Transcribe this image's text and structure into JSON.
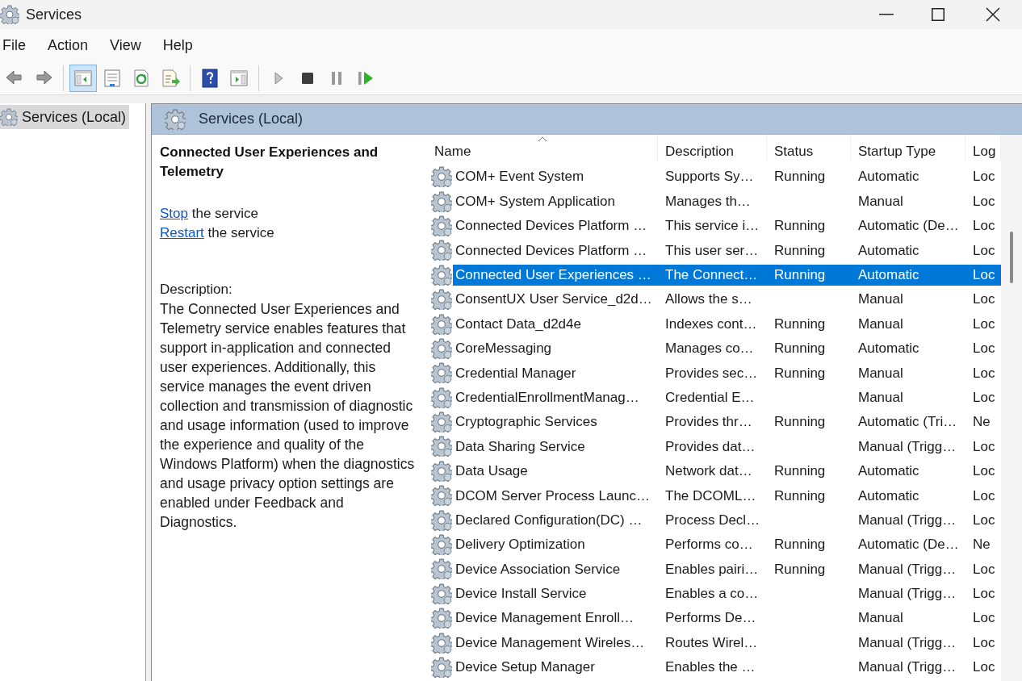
{
  "window": {
    "title": "Services"
  },
  "menu": [
    "File",
    "Action",
    "View",
    "Help"
  ],
  "toolbar": [
    {
      "kind": "back",
      "selected": false
    },
    {
      "kind": "forward",
      "selected": false
    },
    {
      "kind": "separator"
    },
    {
      "kind": "tree",
      "selected": true
    },
    {
      "kind": "properties",
      "selected": false
    },
    {
      "kind": "refresh",
      "selected": false
    },
    {
      "kind": "export",
      "selected": false
    },
    {
      "kind": "separator"
    },
    {
      "kind": "help",
      "selected": false
    },
    {
      "kind": "pane",
      "selected": false
    },
    {
      "kind": "separator"
    },
    {
      "kind": "start",
      "selected": false
    },
    {
      "kind": "stop",
      "selected": false
    },
    {
      "kind": "pause",
      "selected": false
    },
    {
      "kind": "resume",
      "selected": false
    }
  ],
  "tree": [
    {
      "label": "Services (Local)",
      "selected": true
    }
  ],
  "panel": {
    "title": "Services (Local)"
  },
  "details": {
    "title": "Connected User Experiences and Telemetry",
    "actions": [
      {
        "link": "Stop",
        "text": "the service"
      },
      {
        "link": "Restart",
        "text": "the service"
      }
    ],
    "description_label": "Description:",
    "description": "The Connected User Experiences and Telemetry service enables features that support in-application and connected user experiences. Additionally, this service manages the event driven collection and transmission of diagnostic and usage information (used to improve the experience and quality of the Windows Platform) when the diagnostics and usage privacy option settings are enabled under Feedback and Diagnostics."
  },
  "table": {
    "columns": [
      {
        "label": "Name",
        "sorted": true
      },
      {
        "label": "Description"
      },
      {
        "label": "Status"
      },
      {
        "label": "Startup Type"
      },
      {
        "label": "Log"
      }
    ],
    "rows": [
      {
        "name": "COM+ Event System",
        "description": "Supports Sy…",
        "status": "Running",
        "startup_type": "Automatic",
        "column_5": "Loc",
        "selected": false
      },
      {
        "name": "COM+ System Application",
        "description": "Manages th…",
        "startup_type": "Manual",
        "column_5": "Loc",
        "selected": false
      },
      {
        "name": "Connected Devices Platform …",
        "description": "This service i…",
        "status": "Running",
        "startup_type": "Automatic (De…",
        "column_5": "Loc",
        "selected": false
      },
      {
        "name": "Connected Devices Platform …",
        "description": "This user ser…",
        "status": "Running",
        "startup_type": "Automatic",
        "column_5": "Loc",
        "selected": false
      },
      {
        "name": "Connected User Experiences …",
        "description": "The Connect…",
        "status": "Running",
        "startup_type": "Automatic",
        "column_5": "Loc",
        "selected": true
      },
      {
        "name": "ConsentUX User Service_d2d…",
        "description": "Allows the s…",
        "startup_type": "Manual",
        "column_5": "Loc",
        "selected": false
      },
      {
        "name": "Contact Data_d2d4e",
        "description": "Indexes cont…",
        "status": "Running",
        "startup_type": "Manual",
        "column_5": "Loc",
        "selected": false
      },
      {
        "name": "CoreMessaging",
        "description": "Manages co…",
        "status": "Running",
        "startup_type": "Automatic",
        "column_5": "Loc",
        "selected": false
      },
      {
        "name": "Credential Manager",
        "description": "Provides sec…",
        "status": "Running",
        "startup_type": "Manual",
        "column_5": "Loc",
        "selected": false
      },
      {
        "name": "CredentialEnrollmentManag…",
        "description": "Credential E…",
        "startup_type": "Manual",
        "column_5": "Loc",
        "selected": false
      },
      {
        "name": "Cryptographic Services",
        "description": "Provides thr…",
        "status": "Running",
        "startup_type": "Automatic (Tri…",
        "column_5": "Ne",
        "selected": false
      },
      {
        "name": "Data Sharing Service",
        "description": "Provides dat…",
        "startup_type": "Manual (Trigg…",
        "column_5": "Loc",
        "selected": false
      },
      {
        "name": "Data Usage",
        "description": "Network dat…",
        "status": "Running",
        "startup_type": "Automatic",
        "column_5": "Loc",
        "selected": false
      },
      {
        "name": "DCOM Server Process Launc…",
        "description": "The DCOML…",
        "status": "Running",
        "startup_type": "Automatic",
        "column_5": "Loc",
        "selected": false
      },
      {
        "name": "Declared Configuration(DC) …",
        "description": "Process Decl…",
        "startup_type": "Manual (Trigg…",
        "column_5": "Loc",
        "selected": false
      },
      {
        "name": "Delivery Optimization",
        "description": "Performs co…",
        "status": "Running",
        "startup_type": "Automatic (De…",
        "column_5": "Ne",
        "selected": false
      },
      {
        "name": "Device Association Service",
        "description": "Enables pairi…",
        "status": "Running",
        "startup_type": "Manual (Trigg…",
        "column_5": "Loc",
        "selected": false
      },
      {
        "name": "Device Install Service",
        "description": "Enables a co…",
        "startup_type": "Manual (Trigg…",
        "column_5": "Loc",
        "selected": false
      },
      {
        "name": "Device Management Enroll…",
        "description": "Performs De…",
        "startup_type": "Manual",
        "column_5": "Loc",
        "selected": false
      },
      {
        "name": "Device Management Wireles…",
        "description": "Routes Wirel…",
        "startup_type": "Manual (Trigg…",
        "column_5": "Loc",
        "selected": false
      },
      {
        "name": "Device Setup Manager",
        "description": "Enables the …",
        "startup_type": "Manual (Trigg…",
        "column_5": "Loc",
        "selected": false
      }
    ]
  }
}
